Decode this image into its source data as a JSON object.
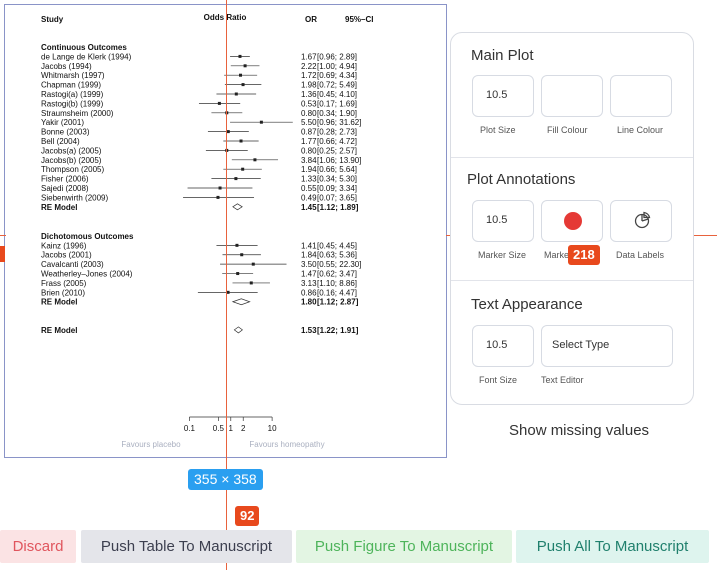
{
  "forest_plot": {
    "headers": {
      "study": "Study",
      "odds_ratio": "Odds Ratio",
      "or": "OR",
      "ci": "95%–CI"
    },
    "groups": [
      {
        "title": "Continuous Outcomes",
        "studies": [
          {
            "name": "de Lange de Klerk (1994)",
            "or": "1.67",
            "ci": "[0.96; 2.89]",
            "est": 1.67,
            "lo": 0.96,
            "hi": 2.89
          },
          {
            "name": "Jacobs (1994)",
            "or": "2.22",
            "ci": "[1.00; 4.94]",
            "est": 2.22,
            "lo": 1.0,
            "hi": 4.94
          },
          {
            "name": "Whitmarsh (1997)",
            "or": "1.72",
            "ci": "[0.69; 4.34]",
            "est": 1.72,
            "lo": 0.69,
            "hi": 4.34
          },
          {
            "name": "Chapman (1999)",
            "or": "1.98",
            "ci": "[0.72; 5.49]",
            "est": 1.98,
            "lo": 0.72,
            "hi": 5.49
          },
          {
            "name": "Rastogi(a) (1999)",
            "or": "1.36",
            "ci": "[0.45; 4.10]",
            "est": 1.36,
            "lo": 0.45,
            "hi": 4.1
          },
          {
            "name": "Rastogi(b) (1999)",
            "or": "0.53",
            "ci": "[0.17; 1.69]",
            "est": 0.53,
            "lo": 0.17,
            "hi": 1.69
          },
          {
            "name": "Straumsheim (2000)",
            "or": "0.80",
            "ci": "[0.34; 1.90]",
            "est": 0.8,
            "lo": 0.34,
            "hi": 1.9
          },
          {
            "name": "Yakir (2001)",
            "or": "5.50",
            "ci": "[0.96; 31.62]",
            "est": 5.5,
            "lo": 0.96,
            "hi": 31.62
          },
          {
            "name": "Bonne (2003)",
            "or": "0.87",
            "ci": "[0.28; 2.73]",
            "est": 0.87,
            "lo": 0.28,
            "hi": 2.73
          },
          {
            "name": "Bell (2004)",
            "or": "1.77",
            "ci": "[0.66; 4.72]",
            "est": 1.77,
            "lo": 0.66,
            "hi": 4.72
          },
          {
            "name": "Jacobs(a) (2005)",
            "or": "0.80",
            "ci": "[0.25; 2.57]",
            "est": 0.8,
            "lo": 0.25,
            "hi": 2.57
          },
          {
            "name": "Jacobs(b) (2005)",
            "or": "3.84",
            "ci": "[1.06; 13.90]",
            "est": 3.84,
            "lo": 1.06,
            "hi": 13.9
          },
          {
            "name": "Thompson (2005)",
            "or": "1.94",
            "ci": "[0.66; 5.64]",
            "est": 1.94,
            "lo": 0.66,
            "hi": 5.64
          },
          {
            "name": "Fisher (2006)",
            "or": "1.33",
            "ci": "[0.34; 5.30]",
            "est": 1.33,
            "lo": 0.34,
            "hi": 5.3
          },
          {
            "name": "Sajedi (2008)",
            "or": "0.55",
            "ci": "[0.09; 3.34]",
            "est": 0.55,
            "lo": 0.09,
            "hi": 3.34
          },
          {
            "name": "Siebenwirth (2009)",
            "or": "0.49",
            "ci": "[0.07; 3.65]",
            "est": 0.49,
            "lo": 0.07,
            "hi": 3.65
          }
        ],
        "summary": {
          "name": "RE Model",
          "or": "1.45",
          "ci": "[1.12; 1.89]",
          "est": 1.45,
          "lo": 1.12,
          "hi": 1.89
        }
      },
      {
        "title": "Dichotomous Outcomes",
        "studies": [
          {
            "name": "Kainz (1996)",
            "or": "1.41",
            "ci": "[0.45; 4.45]",
            "est": 1.41,
            "lo": 0.45,
            "hi": 4.45
          },
          {
            "name": "Jacobs (2001)",
            "or": "1.84",
            "ci": "[0.63; 5.36]",
            "est": 1.84,
            "lo": 0.63,
            "hi": 5.36
          },
          {
            "name": "Cavalcanti (2003)",
            "or": "3.50",
            "ci": "[0.55; 22.30]",
            "est": 3.5,
            "lo": 0.55,
            "hi": 22.3
          },
          {
            "name": "Weatherley–Jones (2004)",
            "or": "1.47",
            "ci": "[0.62; 3.47]",
            "est": 1.47,
            "lo": 0.62,
            "hi": 3.47
          },
          {
            "name": "Frass (2005)",
            "or": "3.13",
            "ci": "[1.10; 8.86]",
            "est": 3.13,
            "lo": 1.1,
            "hi": 8.86
          },
          {
            "name": "Brien (2010)",
            "or": "0.86",
            "ci": "[0.16; 4.47]",
            "est": 0.86,
            "lo": 0.16,
            "hi": 4.47
          }
        ],
        "summary": {
          "name": "RE Model",
          "or": "1.80",
          "ci": "[1.12; 2.87]",
          "est": 1.8,
          "lo": 1.12,
          "hi": 2.87
        }
      }
    ],
    "overall": {
      "name": "RE Model",
      "or": "1.53",
      "ci": "[1.22; 1.91]",
      "est": 1.53,
      "lo": 1.22,
      "hi": 1.91
    },
    "axis": {
      "scale": "log",
      "ticks": [
        0.1,
        0.5,
        1,
        2,
        10
      ],
      "tick_labels": [
        "0.1",
        "0.5",
        "1",
        "2",
        "10"
      ]
    },
    "favours_left": "Favours placebo",
    "favours_right": "Favours homeopathy"
  },
  "guides": {
    "width_height_label": "355 × 358",
    "height_label": "92",
    "offset_label": "218"
  },
  "panel": {
    "main_plot": {
      "title": "Main Plot",
      "plot_size_value": "10.5",
      "plot_size_label": "Plot Size",
      "fill_colour_label": "Fill Colour",
      "line_colour_label": "Line Colour"
    },
    "annotations": {
      "title": "Plot Annotations",
      "marker_size_value": "10.5",
      "marker_size_label": "Marker Size",
      "marker_label": "Marke",
      "marker_color": "#e53935",
      "data_labels_label": "Data Labels",
      "data_labels_icon": "pie-chart-icon"
    },
    "text_appearance": {
      "title": "Text Appearance",
      "font_size_value": "10.5",
      "font_size_label": "Font Size",
      "text_editor_value": "Select Type",
      "text_editor_label": "Text Editor"
    }
  },
  "show_missing_values": "Show missing values",
  "buttons": {
    "discard": "Discard",
    "push_table": "Push Table To Manuscript",
    "push_figure": "Push Figure To Manuscript",
    "push_all": "Push All To Manuscript"
  },
  "colors": {
    "guide": "#e8623d",
    "tag": "#e8491d",
    "selection": "#8a94c8",
    "size_tag": "#2a9ff0"
  }
}
